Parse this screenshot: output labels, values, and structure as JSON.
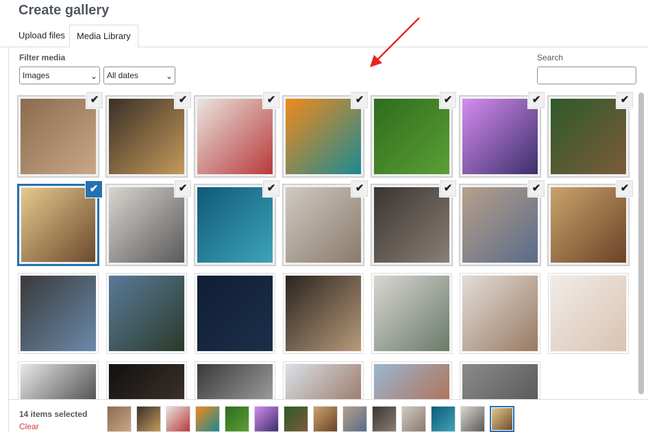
{
  "header": {
    "title": "Create gallery"
  },
  "tabs": [
    {
      "label": "Upload files",
      "active": false
    },
    {
      "label": "Media Library",
      "active": true
    }
  ],
  "filters": {
    "label": "Filter media",
    "type_value": "Images",
    "date_value": "All dates"
  },
  "search": {
    "label": "Search",
    "value": ""
  },
  "icons": {
    "check": "checkmark-icon",
    "dropdown": "chevron-down-icon",
    "annotation": "red-arrow"
  },
  "colors": {
    "accent": "#2271b1",
    "danger": "#d63638",
    "annotation": "#e8261c"
  },
  "tiles": [
    {
      "subject": "hands planting seedling",
      "selected": true,
      "c1": "#8b6a4f",
      "c2": "#c8a887"
    },
    {
      "subject": "chess pieces with crown",
      "selected": true,
      "c1": "#3a3028",
      "c2": "#c49a5a"
    },
    {
      "subject": "woman at desk",
      "selected": true,
      "c1": "#e9e4de",
      "c2": "#b83a3a"
    },
    {
      "subject": "orange teal paint",
      "selected": true,
      "c1": "#f08a1c",
      "c2": "#1c8a92"
    },
    {
      "subject": "golf ball on green",
      "selected": true,
      "c1": "#2f6b1e",
      "c2": "#5aa035"
    },
    {
      "subject": "silhouette photographer",
      "selected": true,
      "c1": "#d58cf0",
      "c2": "#3b2f6a"
    },
    {
      "subject": "woman with camera",
      "selected": true,
      "c1": "#2f5a2a",
      "c2": "#7a5b3a"
    },
    {
      "subject": "ukulele player",
      "selected": true,
      "focus": true,
      "c1": "#e7c98b",
      "c2": "#6a4a2e"
    },
    {
      "subject": "laptop on desk",
      "selected": true,
      "c1": "#d9d4cf",
      "c2": "#5a5a5a"
    },
    {
      "subject": "surfer in wave",
      "selected": true,
      "c1": "#0f5a7a",
      "c2": "#3ea3b8"
    },
    {
      "subject": "woman in studio",
      "selected": true,
      "c1": "#cfcac3",
      "c2": "#8a7a6a"
    },
    {
      "subject": "photographer in dark room",
      "selected": true,
      "c1": "#3a3532",
      "c2": "#8a7e74"
    },
    {
      "subject": "paint palette",
      "selected": true,
      "c1": "#b6a08a",
      "c2": "#5a6a8a"
    },
    {
      "subject": "guitar close-up",
      "selected": true,
      "c1": "#caa36b",
      "c2": "#6a4327"
    },
    {
      "subject": "camera held by person",
      "selected": false,
      "c1": "#3a3a3a",
      "c2": "#6a8aaa"
    },
    {
      "subject": "fishing rod by lake",
      "selected": false,
      "c1": "#5a7a9a",
      "c2": "#2a3a2a"
    },
    {
      "subject": "night sky",
      "selected": false,
      "c1": "#0f1e33",
      "c2": "#1c2e4a"
    },
    {
      "subject": "painting sketchbook",
      "selected": false,
      "c1": "#2a2420",
      "c2": "#b89a7a"
    },
    {
      "subject": "open office",
      "selected": false,
      "c1": "#d8d6d2",
      "c2": "#6a7a6a"
    },
    {
      "subject": "hands on laptop",
      "selected": false,
      "c1": "#e2ddd8",
      "c2": "#9a7a62"
    },
    {
      "subject": "woman in dress",
      "selected": false,
      "c1": "#f1ece8",
      "c2": "#d9c2b0"
    },
    {
      "subject": "man in black sweater",
      "selected": false,
      "c1": "#e8e8e8",
      "c2": "#1e1e1e"
    },
    {
      "subject": "man with camera in dark",
      "selected": false,
      "c1": "#111111",
      "c2": "#4a3a30"
    },
    {
      "subject": "smiling man portrait",
      "selected": false,
      "c1": "#3a3a3a",
      "c2": "#bdbdbd"
    },
    {
      "subject": "woman portrait",
      "selected": false,
      "c1": "#d8e0e8",
      "c2": "#8a5a42"
    },
    {
      "subject": "red-haired woman",
      "selected": false,
      "c1": "#9ab8d0",
      "c2": "#b85a32"
    },
    {
      "subject": "city buildings",
      "selected": false,
      "c1": "#8a8a8a",
      "c2": "#4a4a4a"
    }
  ],
  "footer": {
    "count_text": "14 items selected",
    "clear_label": "Clear"
  },
  "selection_strip": [
    {
      "c1": "#8b6a4f",
      "c2": "#c8a887"
    },
    {
      "c1": "#3a3028",
      "c2": "#c49a5a"
    },
    {
      "c1": "#e9e4de",
      "c2": "#b83a3a"
    },
    {
      "c1": "#f08a1c",
      "c2": "#1c8a92"
    },
    {
      "c1": "#2f6b1e",
      "c2": "#5aa035"
    },
    {
      "c1": "#d58cf0",
      "c2": "#3b2f6a"
    },
    {
      "c1": "#2f5a2a",
      "c2": "#7a5b3a"
    },
    {
      "c1": "#caa36b",
      "c2": "#6a4327"
    },
    {
      "c1": "#b6a08a",
      "c2": "#5a6a8a"
    },
    {
      "c1": "#3a3532",
      "c2": "#8a7e74"
    },
    {
      "c1": "#cfcac3",
      "c2": "#8a7a6a"
    },
    {
      "c1": "#0f5a7a",
      "c2": "#3ea3b8"
    },
    {
      "c1": "#d9d4cf",
      "c2": "#5a5a5a"
    },
    {
      "c1": "#e7c98b",
      "c2": "#6a4a2e",
      "active": true
    }
  ]
}
